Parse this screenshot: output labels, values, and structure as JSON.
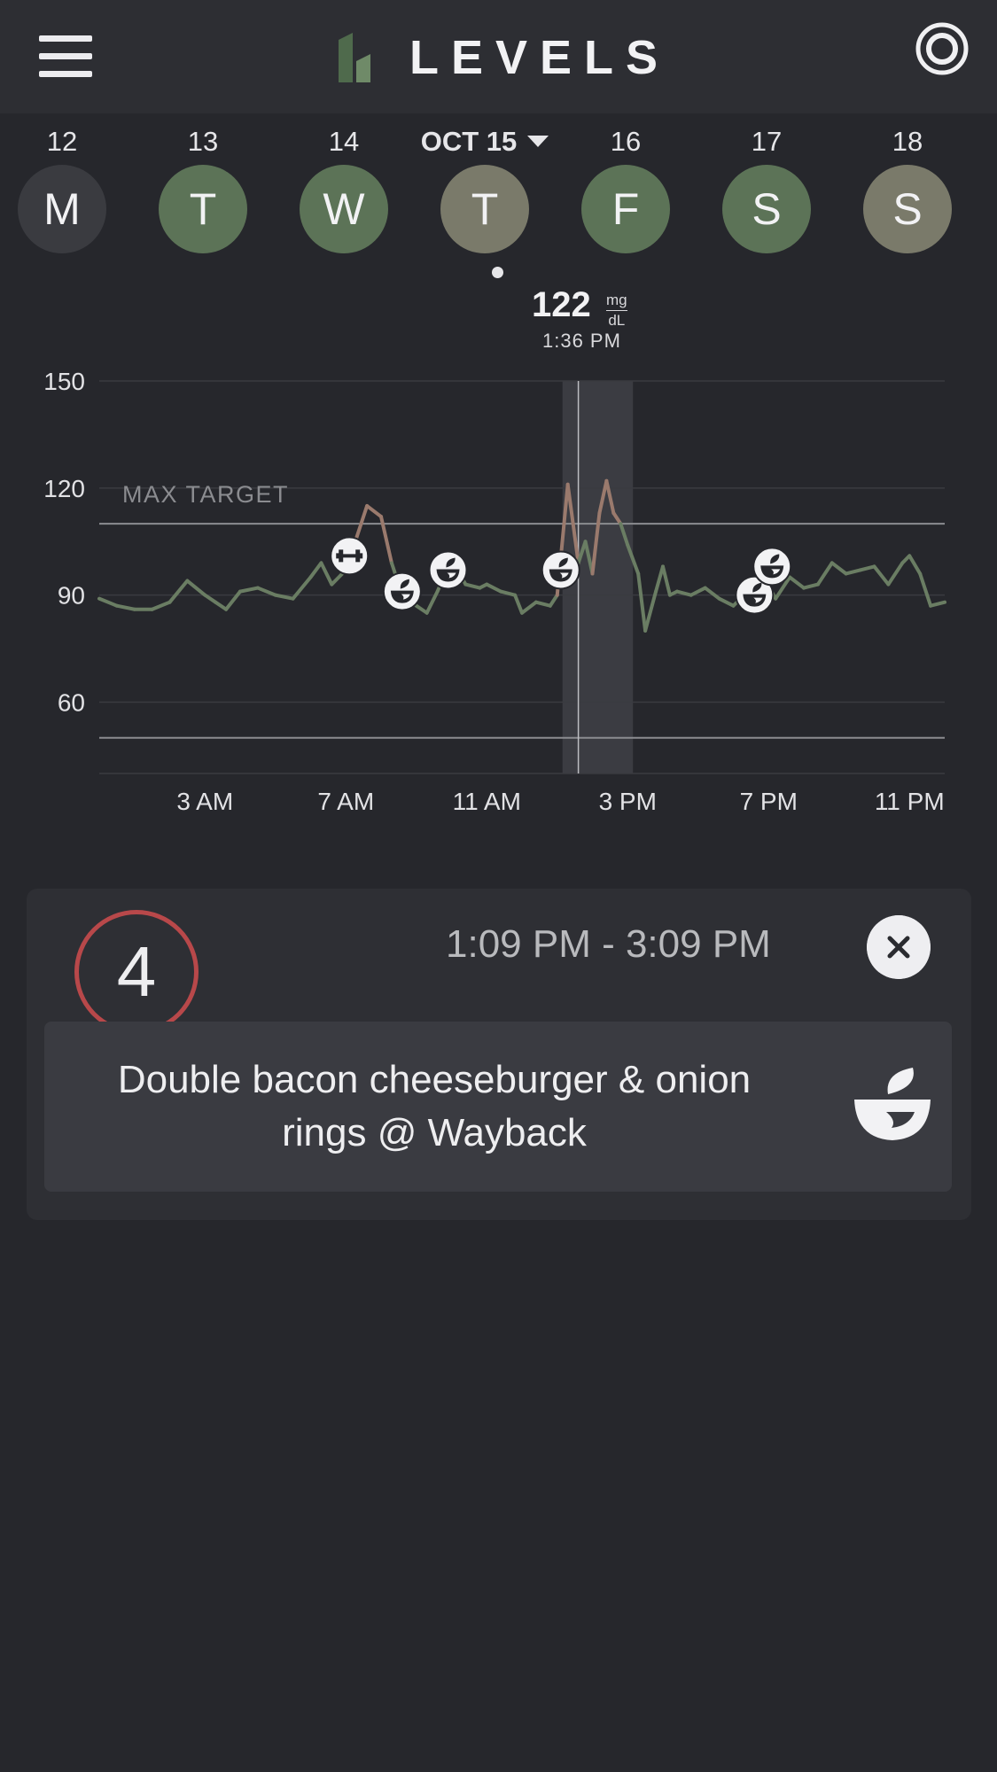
{
  "app": {
    "title": "LEVELS"
  },
  "colors": {
    "bg": "#26272c",
    "header": "#2d2e33",
    "green_day": "#5c7357",
    "olive_day": "#7a7a6a",
    "grey_day": "#3a3b40",
    "score_ring": "#b8484a",
    "curve_normal": "#6a7d63",
    "curve_high": "#9a7a6d"
  },
  "days": [
    {
      "num": "12",
      "letter": "M",
      "color": "#3a3b40"
    },
    {
      "num": "13",
      "letter": "T",
      "color": "#5c7357"
    },
    {
      "num": "14",
      "letter": "W",
      "color": "#5c7357"
    },
    {
      "num": "OCT 15",
      "letter": "T",
      "color": "#7a7a6a",
      "selected": true
    },
    {
      "num": "16",
      "letter": "F",
      "color": "#5c7357"
    },
    {
      "num": "17",
      "letter": "S",
      "color": "#5c7357"
    },
    {
      "num": "18",
      "letter": "S",
      "color": "#7a7a6a"
    }
  ],
  "readout": {
    "value": "122",
    "unit_top": "mg",
    "unit_bottom": "dL",
    "time": "1:36 PM"
  },
  "chart_data": {
    "type": "line",
    "ylim": [
      40,
      150
    ],
    "yticks": [
      "150",
      "120",
      "90",
      "60"
    ],
    "ytick_values": [
      150,
      120,
      90,
      60
    ],
    "xticks": [
      "3 AM",
      "7 AM",
      "11 AM",
      "3 PM",
      "7 PM",
      "11 PM"
    ],
    "xtick_values": [
      3,
      7,
      11,
      15,
      19,
      23
    ],
    "xlim": [
      0,
      24
    ],
    "target_label": "MAX TARGET",
    "target_upper": 110,
    "target_lower": 50,
    "highlight_window": [
      13.15,
      15.15
    ],
    "cursor_hour": 13.6,
    "series": [
      {
        "x": [
          0,
          0.5,
          1,
          1.5,
          2,
          2.5,
          3,
          3.3,
          3.6,
          4,
          4.5,
          5,
          5.5,
          6,
          6.3,
          6.6,
          7,
          7.3,
          7.6,
          8,
          8.3,
          8.6,
          9,
          9.3,
          9.6,
          10,
          10.4,
          10.8,
          11,
          11.4,
          11.8,
          12,
          12.4,
          12.8,
          13,
          13.3,
          13.6,
          13.8,
          14,
          14.2,
          14.4,
          14.6,
          14.8,
          15,
          15.3,
          15.5,
          15.8,
          16,
          16.2,
          16.4,
          16.8,
          17.2,
          17.6,
          18,
          18.4,
          18.8,
          19.2,
          19.6,
          20,
          20.4,
          20.8,
          21.2,
          21.6,
          22,
          22.4,
          22.8,
          23,
          23.3,
          23.6,
          24
        ],
        "y": [
          89,
          87,
          86,
          86,
          88,
          94,
          90,
          88,
          86,
          91,
          92,
          90,
          89,
          95,
          99,
          93,
          97,
          106,
          115,
          112,
          99,
          90,
          87,
          85,
          91,
          100,
          93,
          92,
          93,
          91,
          90,
          85,
          88,
          87,
          90,
          121,
          99,
          105,
          96,
          113,
          122,
          113,
          110,
          104,
          96,
          80,
          91,
          98,
          90,
          91,
          90,
          92,
          89,
          87,
          91,
          96,
          89,
          95,
          92,
          93,
          99,
          96,
          97,
          98,
          93,
          99,
          101,
          96,
          87,
          88
        ]
      }
    ],
    "events": [
      {
        "x": 7.1,
        "y": 101,
        "icon": "workout-icon"
      },
      {
        "x": 8.6,
        "y": 91,
        "icon": "meal-icon"
      },
      {
        "x": 9.9,
        "y": 97,
        "icon": "meal-icon"
      },
      {
        "x": 13.1,
        "y": 97,
        "icon": "meal-icon"
      },
      {
        "x": 18.6,
        "y": 90,
        "icon": "meal-icon"
      },
      {
        "x": 19.1,
        "y": 98,
        "icon": "meal-icon"
      }
    ]
  },
  "card": {
    "score": "4",
    "time_range": "1:09 PM - 3:09 PM",
    "meal": "Double bacon cheeseburger & onion rings @ Wayback"
  }
}
